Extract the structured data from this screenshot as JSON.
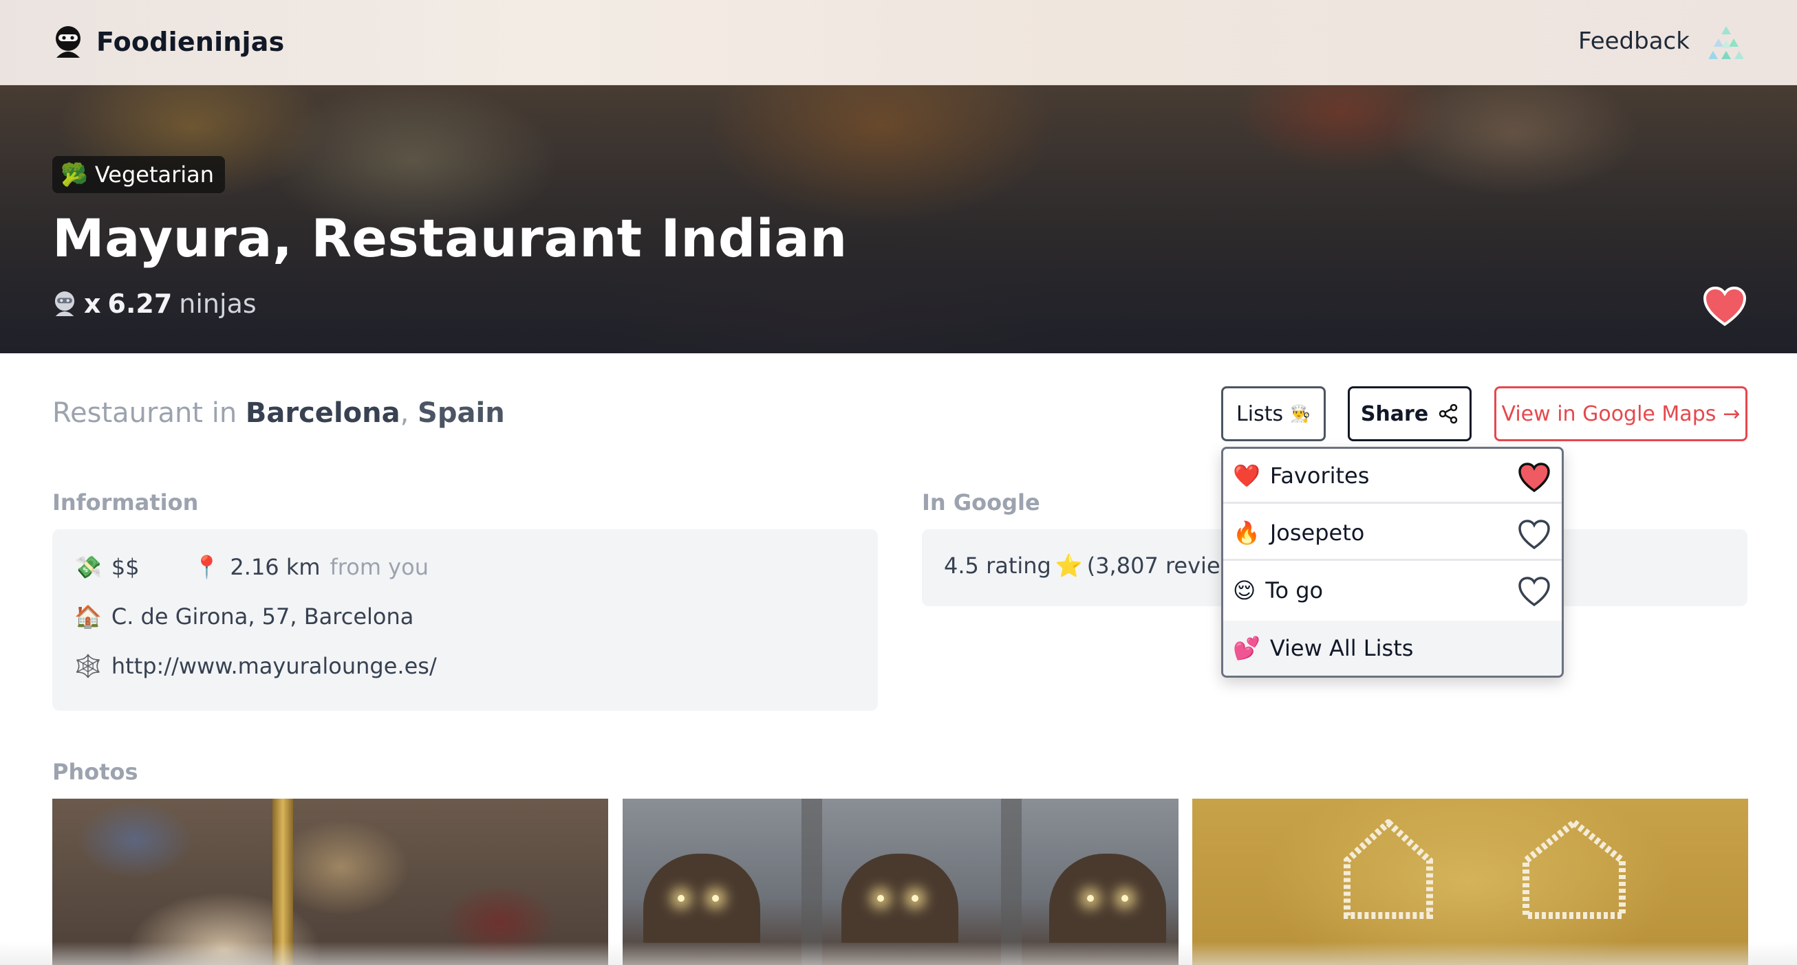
{
  "header": {
    "brand_name": "Foodieninjas",
    "feedback_label": "Feedback"
  },
  "hero": {
    "badge_emoji": "🥦",
    "badge_label": "Vegetarian",
    "title": "Mayura, Restaurant Indian",
    "ninja_prefix": "x",
    "ninja_value": "6.27",
    "ninja_unit": "ninjas",
    "favorited": true
  },
  "location": {
    "prefix": "Restaurant in",
    "city": "Barcelona",
    "separator": ",",
    "country": "Spain"
  },
  "actions": {
    "lists_label": "Lists",
    "lists_emoji": "👨‍🍳",
    "share_label": "Share",
    "maps_label": "View in Google Maps",
    "maps_arrow": "→"
  },
  "information": {
    "heading": "Information",
    "price_emoji": "💸",
    "price": "$$",
    "distance_emoji": "📍",
    "distance": "2.16 km",
    "distance_suffix": "from you",
    "address_emoji": "🏠",
    "address": "C. de Girona, 57, Barcelona",
    "website_emoji": "🕸️",
    "website": "http://www.mayuralounge.es/"
  },
  "google": {
    "heading": "In Google",
    "rating_text": "4.5 rating",
    "rating_emoji": "⭐",
    "reviews_text": "(3,807 reviews"
  },
  "lists_dropdown": {
    "items": [
      {
        "emoji": "❤️",
        "label": "Favorites",
        "in_list": true
      },
      {
        "emoji": "🔥",
        "label": "Josepeto",
        "in_list": false
      },
      {
        "emoji": "😌",
        "label": "To go",
        "in_list": false
      }
    ],
    "footer_emoji": "💕",
    "footer_label": "View All Lists"
  },
  "photos": {
    "heading": "Photos"
  },
  "colors": {
    "accent_red": "#e5484d",
    "heart_red": "#f05a63",
    "text_dark": "#111827",
    "muted_gray": "#9ca3af",
    "panel_bg": "#f3f4f6"
  },
  "icons": {
    "brand": "ninja-icon",
    "avatar": "triangle-logo-icon",
    "share": "share-icon",
    "heart": "heart-icon"
  }
}
